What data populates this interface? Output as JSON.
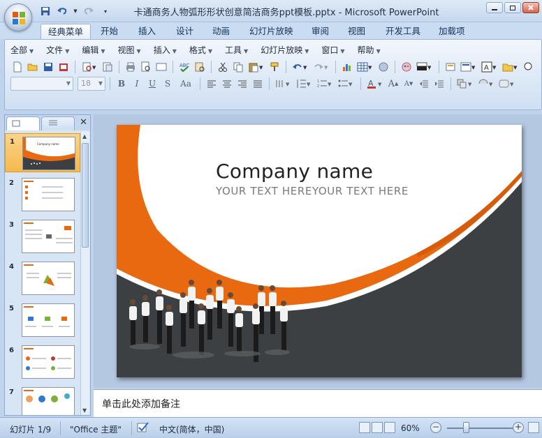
{
  "app": {
    "window_title": "卡通商务人物弧形形状创意简洁商务ppt模板.pptx - Microsoft PowerPoint"
  },
  "ribbon_tabs": [
    {
      "label": "经典菜单",
      "active": true
    },
    {
      "label": "开始"
    },
    {
      "label": "插入"
    },
    {
      "label": "设计"
    },
    {
      "label": "动画"
    },
    {
      "label": "幻灯片放映"
    },
    {
      "label": "审阅"
    },
    {
      "label": "视图"
    },
    {
      "label": "开发工具"
    },
    {
      "label": "加载项"
    }
  ],
  "menus": [
    "全部",
    "文件",
    "编辑",
    "视图",
    "插入",
    "格式",
    "工具",
    "幻灯片放映",
    "窗口",
    "帮助"
  ],
  "format_bar": {
    "font_name": "",
    "font_size": "18"
  },
  "slide": {
    "title": "Company name",
    "subtitle": "YOUR TEXT HEREYOUR TEXT HERE",
    "colors": {
      "accent": "#e8690f",
      "dark": "#3d4043"
    }
  },
  "thumbnails": [
    "1",
    "2",
    "3",
    "4",
    "5",
    "6",
    "7"
  ],
  "notes_placeholder": "单击此处添加备注",
  "statusbar": {
    "slide_info": "幻灯片 1/9",
    "theme": "\"Office 主题\"",
    "language": "中文(简体，中国)",
    "zoom": "60%",
    "zoom_percent": 60
  }
}
